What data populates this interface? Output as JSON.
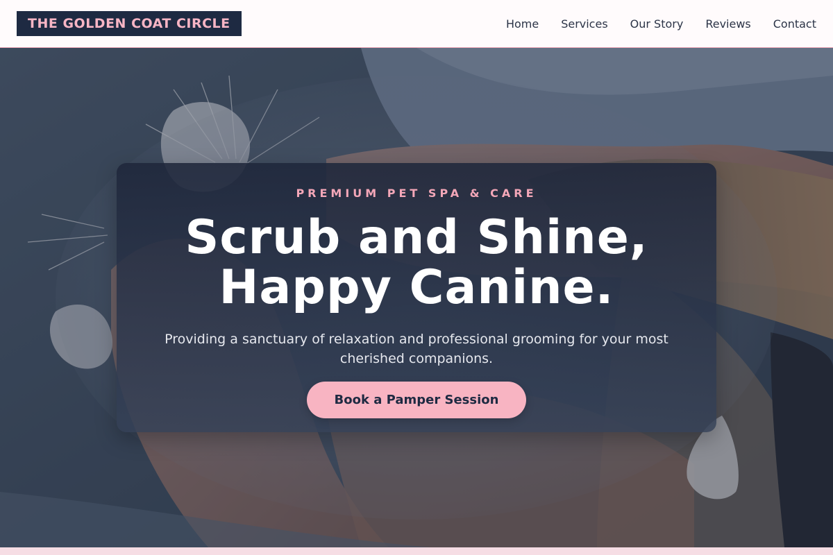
{
  "brand": {
    "name": "THE GOLDEN COAT CIRCLE"
  },
  "nav": {
    "items": [
      {
        "label": "Home"
      },
      {
        "label": "Services"
      },
      {
        "label": "Our Story"
      },
      {
        "label": "Reviews"
      },
      {
        "label": "Contact"
      }
    ]
  },
  "hero": {
    "eyebrow": "PREMIUM PET SPA & CARE",
    "headline_line1": "Scrub and Shine,",
    "headline_line2": "Happy Canine.",
    "subtitle": "Providing a sanctuary of relaxation and professional grooming for your most cherished companions.",
    "cta_label": "Book a Pamper Session",
    "background_image": "cat-being-petted-photo"
  },
  "colors": {
    "brand_navy": "#1e2a42",
    "accent_pink": "#f8b4c2",
    "nav_border": "#f3a9b9"
  }
}
